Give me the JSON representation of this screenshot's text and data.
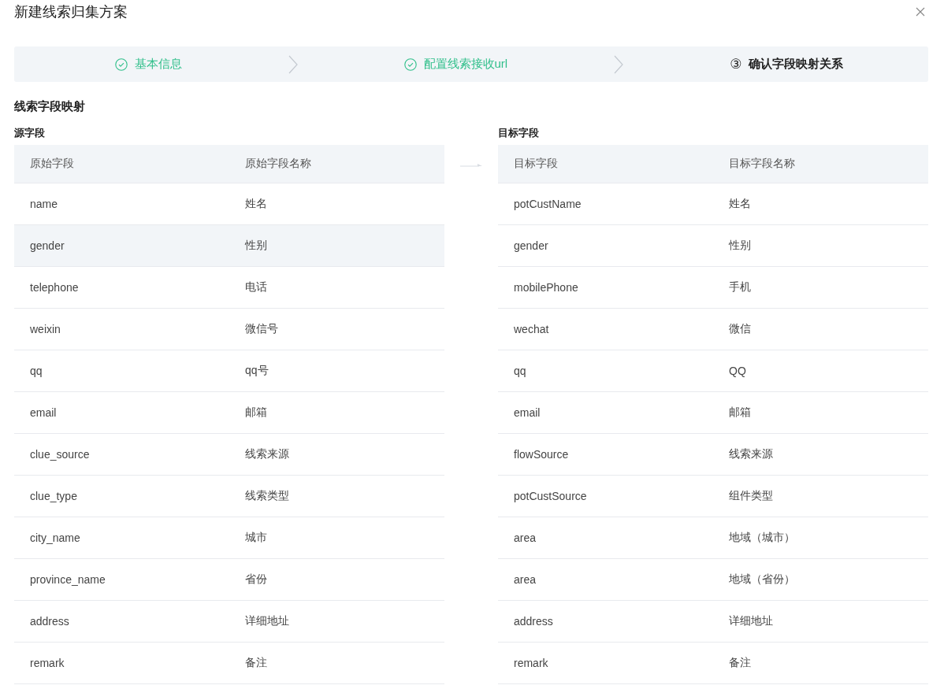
{
  "window": {
    "title": "新建线索归集方案"
  },
  "steps": [
    {
      "label": "基本信息",
      "done": true,
      "selected": false
    },
    {
      "label": "配置线索接收url",
      "done": true,
      "selected": false
    },
    {
      "number": "③",
      "label": "确认字段映射关系",
      "done": false,
      "selected": true
    }
  ],
  "section_title": "线索字段映射",
  "source": {
    "title": "源字段",
    "columns": [
      "原始字段",
      "原始字段名称"
    ],
    "rows": [
      {
        "cells": [
          "name",
          "姓名"
        ],
        "hovered": false
      },
      {
        "cells": [
          "gender",
          "性别"
        ],
        "hovered": true
      },
      {
        "cells": [
          "telephone",
          "电话"
        ],
        "hovered": false
      },
      {
        "cells": [
          "weixin",
          "微信号"
        ],
        "hovered": false
      },
      {
        "cells": [
          "qq",
          "qq号"
        ],
        "hovered": false
      },
      {
        "cells": [
          "email",
          "邮箱"
        ],
        "hovered": false
      },
      {
        "cells": [
          "clue_source",
          "线索来源"
        ],
        "hovered": false
      },
      {
        "cells": [
          "clue_type",
          "线索类型"
        ],
        "hovered": false
      },
      {
        "cells": [
          "city_name",
          "城市"
        ],
        "hovered": false
      },
      {
        "cells": [
          "province_name",
          "省份"
        ],
        "hovered": false
      },
      {
        "cells": [
          "address",
          "详细地址"
        ],
        "hovered": false
      },
      {
        "cells": [
          "remark",
          "备注"
        ],
        "hovered": false
      }
    ]
  },
  "target": {
    "title": "目标字段",
    "columns": [
      "目标字段",
      "目标字段名称"
    ],
    "rows": [
      {
        "cells": [
          "potCustName",
          "姓名"
        ],
        "hovered": false
      },
      {
        "cells": [
          "gender",
          "性别"
        ],
        "hovered": false
      },
      {
        "cells": [
          "mobilePhone",
          "手机"
        ],
        "hovered": false
      },
      {
        "cells": [
          "wechat",
          "微信"
        ],
        "hovered": false
      },
      {
        "cells": [
          "qq",
          "QQ"
        ],
        "hovered": false
      },
      {
        "cells": [
          "email",
          "邮箱"
        ],
        "hovered": false
      },
      {
        "cells": [
          "flowSource",
          "线索来源"
        ],
        "hovered": false
      },
      {
        "cells": [
          "potCustSource",
          "组件类型"
        ],
        "hovered": false
      },
      {
        "cells": [
          "area",
          "地域（城市）"
        ],
        "hovered": false
      },
      {
        "cells": [
          "area",
          "地域（省份）"
        ],
        "hovered": false
      },
      {
        "cells": [
          "address",
          "详细地址"
        ],
        "hovered": false
      },
      {
        "cells": [
          "remark",
          "备注"
        ],
        "hovered": false
      }
    ]
  }
}
